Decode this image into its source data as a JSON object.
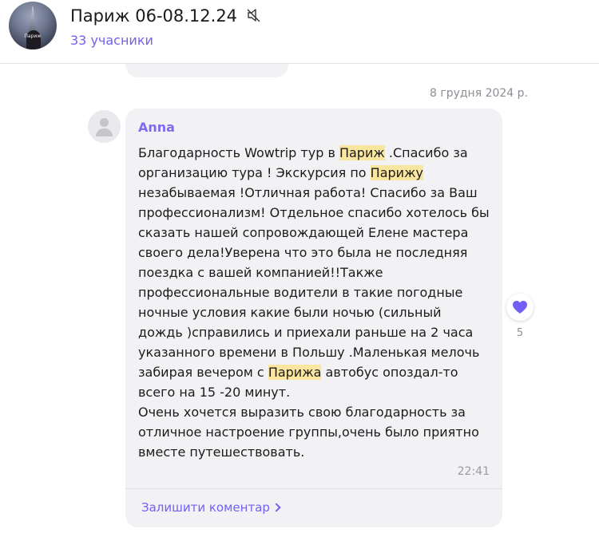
{
  "header": {
    "avatar_label": "Париж",
    "title": "Париж 06-08.12.24",
    "members": "33 учасники"
  },
  "date_separator": "8 грудня 2024 р.",
  "message": {
    "sender": "Anna",
    "lines": [
      [
        {
          "t": "Благодарность Wowtrip  тур в "
        },
        {
          "t": "Париж",
          "hl": true
        },
        {
          "t": " .Спасибо за"
        }
      ],
      [
        {
          "t": "организацию тура ! Экскурсия по "
        },
        {
          "t": "Парижу",
          "hl": true
        },
        {
          "t": ""
        }
      ],
      [
        {
          "t": "незабываемая !Отличная работа! Спасибо за Ваш"
        }
      ],
      [
        {
          "t": "профессионализм! Отдельное спасибо хотелось бы"
        }
      ],
      [
        {
          "t": "сказать нашей сопровождающей Елене мастера"
        }
      ],
      [
        {
          "t": "своего дела!Уверена что это была не последняя"
        }
      ],
      [
        {
          "t": "поездка с  вашей компанией!!Также"
        }
      ],
      [
        {
          "t": "профессиональные водители в такие погодные"
        }
      ],
      [
        {
          "t": "ночные условия какие были ночью (сильный"
        }
      ],
      [
        {
          "t": "дождь )справились и приехали раньше на 2 часа"
        }
      ],
      [
        {
          "t": "указанного времени в Польшу .Маленькая мелочь"
        }
      ],
      [
        {
          "t": "забирая вечером с "
        },
        {
          "t": "Парижа",
          "hl": true
        },
        {
          "t": " автобус  опоздал-то"
        }
      ],
      [
        {
          "t": "всего на 15 -20 минут."
        }
      ],
      [
        {
          "t": "Очень хочется выразить свою благодарность за"
        }
      ],
      [
        {
          "t": "отличное настроение группы,очень было приятно"
        }
      ],
      [
        {
          "t": "вместе путешествовать."
        }
      ]
    ],
    "time": "22:41",
    "comment_link": "Залишити коментар"
  },
  "reaction": {
    "icon": "heart-icon",
    "count": "5",
    "color": "#7360f2"
  }
}
